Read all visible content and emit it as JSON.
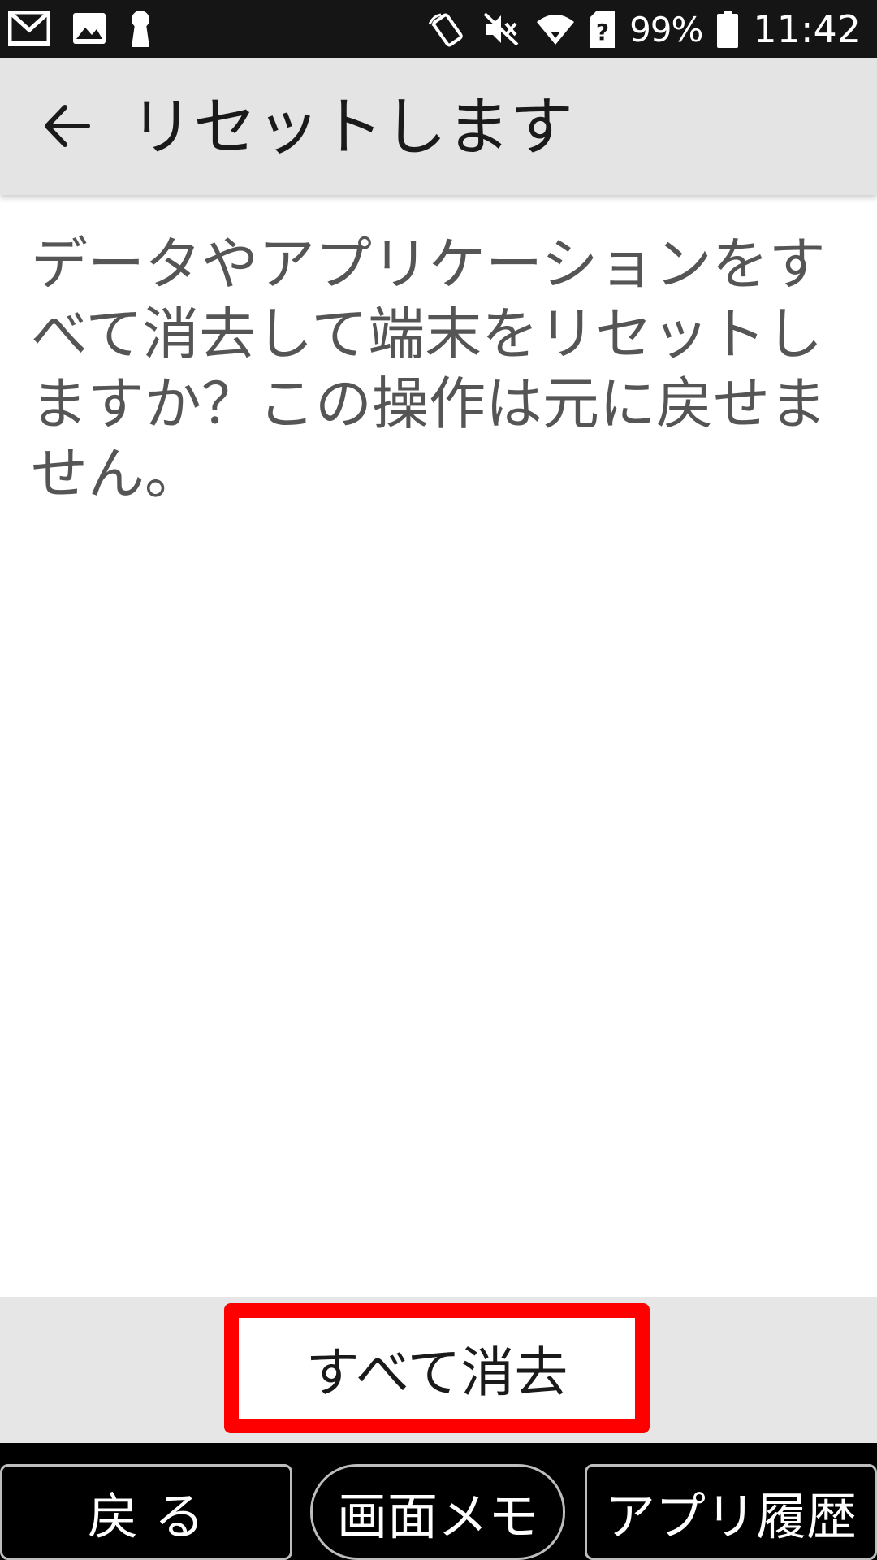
{
  "status_bar": {
    "battery_percent": "99%",
    "time": "11:42",
    "icons": [
      "gmail-icon",
      "image-icon",
      "keyhole-icon",
      "nfc-icon",
      "mute-icon",
      "wifi-icon",
      "sim-unknown-icon",
      "battery-icon"
    ]
  },
  "app_bar": {
    "title": "リセットします"
  },
  "content": {
    "message": "データやアプリケーションをすべて消去して端末をリセットしますか？この操作は元に戻せません。"
  },
  "action": {
    "erase_all_label": "すべて消去",
    "highlight_color": "#ff0000"
  },
  "nav_bar": {
    "back_label": "戻 る",
    "memo_label": "画面メモ",
    "history_label": "アプリ履歴"
  }
}
